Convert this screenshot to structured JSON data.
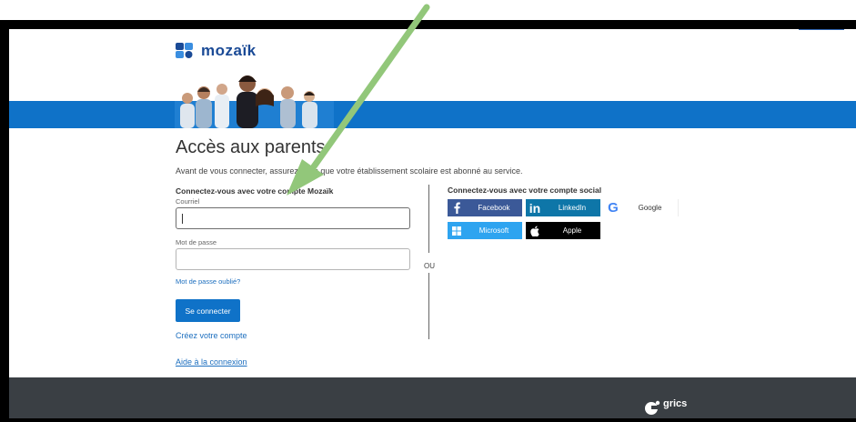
{
  "brand": {
    "logo_icon": "mozaik-logo-icon",
    "name": "mozaïk"
  },
  "colors": {
    "primary": "#0f72c8",
    "footer": "#3a3f44",
    "annotation_arrow": "#92c77a"
  },
  "page": {
    "title": "Accès aux parents",
    "intro": "Avant de vous connecter, assurez-vous que votre établissement scolaire est abonné au service."
  },
  "login": {
    "heading": "Connectez-vous avec votre compte Mozaïk",
    "email_label": "Courriel",
    "email_value": "",
    "password_label": "Mot de passe",
    "password_value": "",
    "forgot_link": "Mot de passe oublié?",
    "submit_label": "Se connecter",
    "create_account_link": "Créez votre compte",
    "help_link": "Aide à la connexion"
  },
  "divider": {
    "label": "OU"
  },
  "social": {
    "heading": "Connectez-vous avec votre compte social",
    "buttons": [
      {
        "label": "Facebook",
        "icon": "facebook-icon",
        "color": "#3b5998"
      },
      {
        "label": "LinkedIn",
        "icon": "linkedin-icon",
        "color": "#0e76a8"
      },
      {
        "label": "Google",
        "icon": "google-icon",
        "color": "#ffffff"
      },
      {
        "label": "Microsoft",
        "icon": "microsoft-icon",
        "color": "#2ea4f0"
      },
      {
        "label": "Apple",
        "icon": "apple-icon",
        "color": "#000000"
      }
    ]
  },
  "footer": {
    "logo_icon": "grics-logo-icon",
    "name": "grics"
  }
}
